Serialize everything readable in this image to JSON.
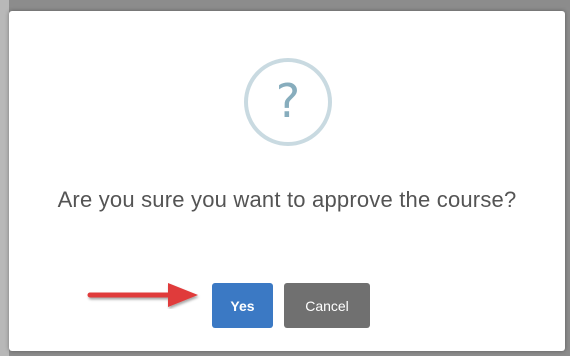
{
  "dialog": {
    "icon": "question-mark-icon",
    "icon_glyph": "?",
    "message": "Are you sure you want to approve the course?",
    "buttons": {
      "yes_label": "Yes",
      "cancel_label": "Cancel"
    }
  },
  "annotation": {
    "arrow_icon": "red-arrow-icon",
    "arrow_color": "#e03a3a"
  },
  "colors": {
    "yes_button": "#3b79c4",
    "cancel_button": "#707070",
    "icon_ring": "#c9dae1",
    "icon_glyph": "#87adbd",
    "message_text": "#545454"
  }
}
